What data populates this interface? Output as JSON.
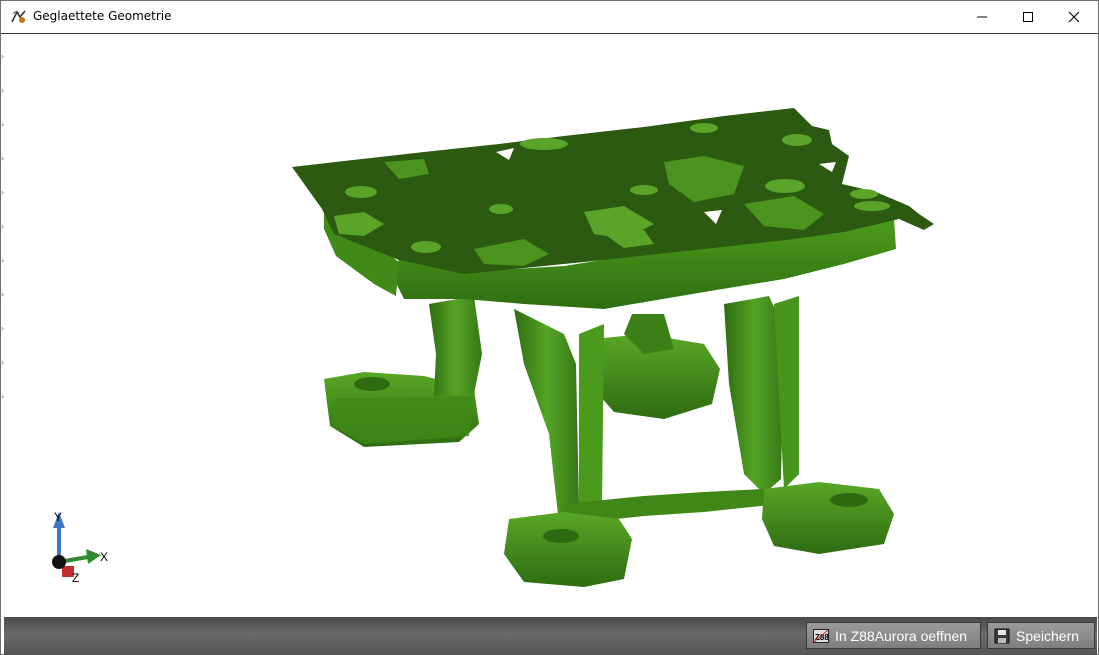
{
  "window": {
    "title": "Geglaettete Geometrie",
    "controls": [
      "minimize",
      "maximize",
      "close"
    ]
  },
  "viewport": {
    "model_color": "#3e8a17",
    "model_dark_color": "#2a5a10",
    "axes": {
      "x_label": "X",
      "y_label": "Y",
      "z_label": "Z"
    }
  },
  "bottombar": {
    "open_button": {
      "label": "In Z88Aurora oeffnen",
      "icon": "z88-icon"
    },
    "save_button": {
      "label": "Speichern",
      "icon": "floppy-disk-icon"
    }
  }
}
